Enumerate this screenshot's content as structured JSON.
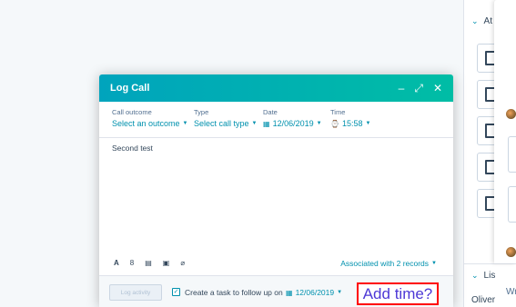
{
  "right_panel": {
    "attachments_header": "At",
    "list_header": "Lis",
    "contact_name": "Oliver",
    "side_text": "Wr"
  },
  "modal": {
    "title": "Log Call",
    "header_controls": {
      "minimize": "–",
      "expand": "⤢",
      "close": "✕"
    },
    "fields": {
      "outcome": {
        "label": "Call outcome",
        "value": "Select an outcome"
      },
      "type": {
        "label": "Type",
        "value": "Select call type"
      },
      "date": {
        "label": "Date",
        "value": "12/06/2019"
      },
      "time": {
        "label": "Time",
        "value": "15:58"
      }
    },
    "body_text": "Second test",
    "toolbar": [
      "A",
      "8",
      "▤",
      "▣",
      "⌀"
    ],
    "associated": "Associated with 2 records",
    "footer": {
      "log_button": "Log activity",
      "task_checked": true,
      "task_label": "Create a task to follow up on",
      "task_date": "12/06/2019"
    }
  },
  "annotation": "Add time?",
  "colors": {
    "header_gradient_start": "#00a4bd",
    "header_gradient_end": "#00bda5",
    "link": "#0091ae",
    "annotation_border": "#ff0000",
    "annotation_text": "#4d38d6"
  }
}
